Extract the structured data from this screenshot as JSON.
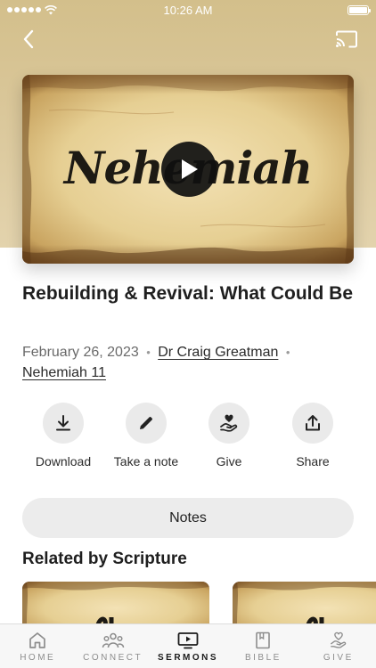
{
  "status_bar": {
    "time": "10:26 AM"
  },
  "hero": {
    "artwork_text": "Nehemiah",
    "back_icon": "chevron-left-icon",
    "cast_icon": "cast-icon",
    "play_icon": "play-icon",
    "background_color": "#d8c595"
  },
  "sermon": {
    "title": "Rebuilding & Revival: What Could Be",
    "date": "February 26, 2023",
    "separator": "•",
    "speaker": "Dr Craig Greatman",
    "scripture": "Nehemiah 11"
  },
  "actions": [
    {
      "label": "Download",
      "icon": "download-icon"
    },
    {
      "label": "Take a note",
      "icon": "pencil-icon"
    },
    {
      "label": "Give",
      "icon": "give-heart-hand-icon"
    },
    {
      "label": "Share",
      "icon": "share-icon"
    }
  ],
  "notes_button": {
    "label": "Notes"
  },
  "related": {
    "heading": "Related by Scripture",
    "items": [
      {
        "artwork": "scroll-thumbnail"
      },
      {
        "artwork": "scroll-thumbnail"
      }
    ]
  },
  "tab_bar": {
    "tabs": [
      {
        "label": "HOME",
        "icon": "home-icon",
        "active": false
      },
      {
        "label": "CONNECT",
        "icon": "people-icon",
        "active": false
      },
      {
        "label": "SERMONS",
        "icon": "video-screen-icon",
        "active": true
      },
      {
        "label": "BIBLE",
        "icon": "book-icon",
        "active": false
      },
      {
        "label": "GIVE",
        "icon": "give-heart-hand-icon",
        "active": false
      }
    ]
  },
  "colors": {
    "accent": "#1b1b1b",
    "inactive": "#8d8d8d",
    "button_bg": "#eaeaea"
  }
}
